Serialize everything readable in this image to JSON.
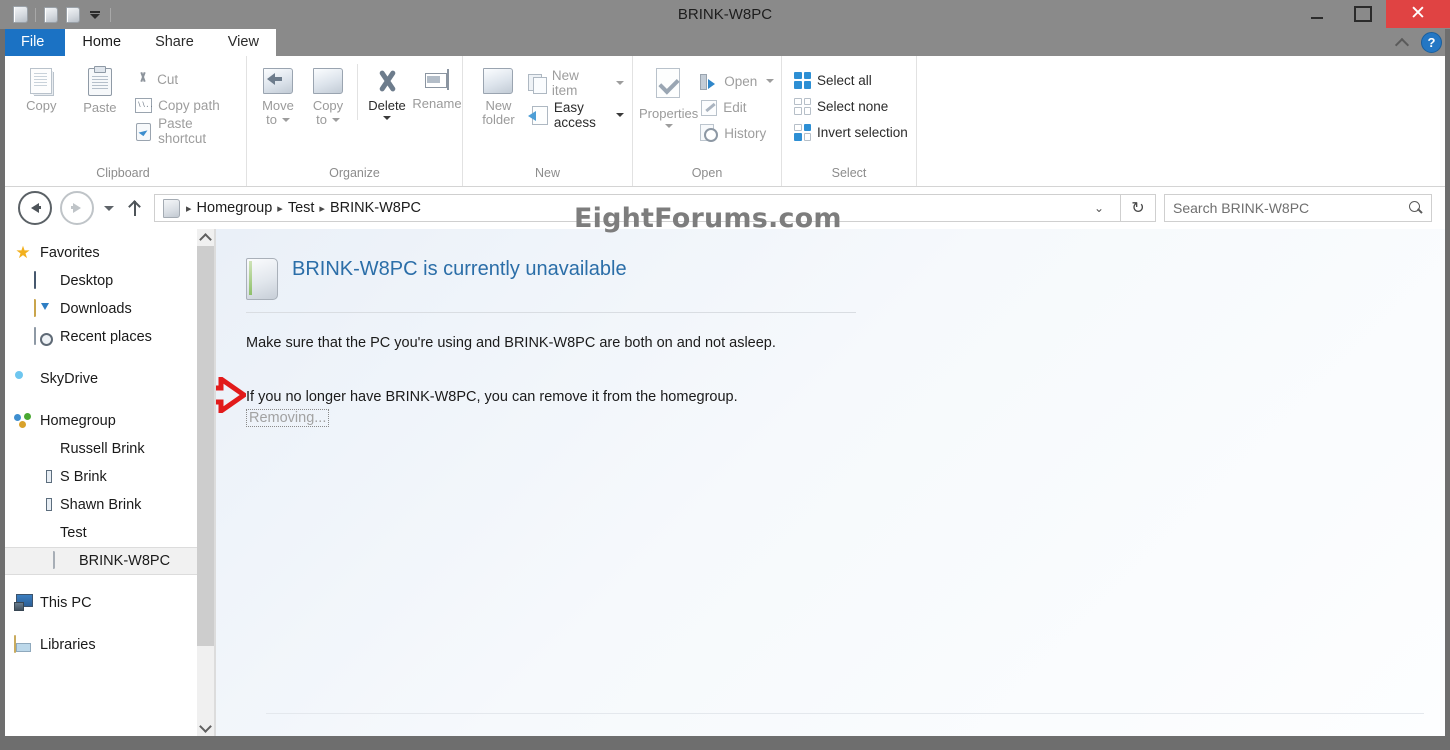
{
  "window": {
    "title": "BRINK-W8PC",
    "quick_access": [
      "folder-icon",
      "properties-icon",
      "new-folder-icon",
      "customize-dropdown-icon"
    ],
    "controls": {
      "minimize": "–",
      "maximize": "☐",
      "close": "✕"
    }
  },
  "ribbon": {
    "tabs": [
      {
        "label": "File",
        "id": "file",
        "active": false
      },
      {
        "label": "Home",
        "id": "home",
        "active": true
      },
      {
        "label": "Share",
        "id": "share",
        "active": false
      },
      {
        "label": "View",
        "id": "view",
        "active": false
      }
    ],
    "collapse_icon": "chevron-up-icon",
    "help_label": "?",
    "groups": [
      {
        "name": "Clipboard",
        "big": [
          {
            "label": "Copy",
            "icon": "copy-icon"
          },
          {
            "label": "Paste",
            "icon": "paste-icon"
          }
        ],
        "small": [
          {
            "label": "Cut",
            "icon": "scissors-icon"
          },
          {
            "label": "Copy path",
            "icon": "copy-path-icon"
          },
          {
            "label": "Paste shortcut",
            "icon": "paste-shortcut-icon"
          }
        ]
      },
      {
        "name": "Organize",
        "big": [
          {
            "label": "Move",
            "label2": "to",
            "icon": "move-to-icon",
            "dropdown": true
          },
          {
            "label": "Copy",
            "label2": "to",
            "icon": "copy-to-icon",
            "dropdown": true
          },
          {
            "label": "Delete",
            "icon": "delete-icon",
            "dropdown": true,
            "enabled": true
          },
          {
            "label": "Rename",
            "icon": "rename-icon"
          }
        ],
        "small": []
      },
      {
        "name": "New",
        "big": [
          {
            "label": "New",
            "label2": "folder",
            "icon": "new-folder-icon"
          }
        ],
        "small": [
          {
            "label": "New item",
            "icon": "new-item-icon",
            "dropdown": true
          },
          {
            "label": "Easy access",
            "icon": "easy-access-icon",
            "dropdown": true,
            "enabled": true
          }
        ]
      },
      {
        "name": "Open",
        "big": [
          {
            "label": "Properties",
            "icon": "properties-icon",
            "dropdown": true
          }
        ],
        "small": [
          {
            "label": "Open",
            "icon": "open-icon",
            "dropdown": true
          },
          {
            "label": "Edit",
            "icon": "edit-icon"
          },
          {
            "label": "History",
            "icon": "history-icon"
          }
        ]
      },
      {
        "name": "Select",
        "big": [],
        "small": [
          {
            "label": "Select all",
            "icon": "select-all-icon",
            "enabled": true
          },
          {
            "label": "Select none",
            "icon": "select-none-icon",
            "enabled": true
          },
          {
            "label": "Invert selection",
            "icon": "invert-selection-icon",
            "enabled": true
          }
        ]
      }
    ]
  },
  "addressbar": {
    "back_icon": "back-arrow-icon",
    "forward_icon": "forward-arrow-icon",
    "recent_icon": "recent-locations-dropdown-icon",
    "up_icon": "up-one-level-icon",
    "breadcrumb_icon": "computer-icon",
    "breadcrumbs": [
      "Homegroup",
      "Test",
      "BRINK-W8PC"
    ],
    "separator": "▸",
    "dropdown_icon": "⌄",
    "refresh_icon": "↻",
    "search_placeholder": "Search BRINK-W8PC",
    "search_value": "",
    "search_icon": "search-icon"
  },
  "navpane": {
    "items": [
      {
        "label": "Favorites",
        "icon": "star-icon",
        "level": 0
      },
      {
        "label": "Desktop",
        "icon": "desktop-icon",
        "level": 1
      },
      {
        "label": "Downloads",
        "icon": "downloads-icon",
        "level": 1
      },
      {
        "label": "Recent places",
        "icon": "recent-places-icon",
        "level": 1
      },
      {
        "label": "",
        "icon": "",
        "level": 0,
        "gap": true
      },
      {
        "label": "SkyDrive",
        "icon": "skydrive-icon",
        "level": 0
      },
      {
        "label": "",
        "icon": "",
        "level": 0,
        "gap": true
      },
      {
        "label": "Homegroup",
        "icon": "homegroup-icon",
        "level": 0
      },
      {
        "label": "Russell Brink",
        "icon": "user-icon",
        "level": 1
      },
      {
        "label": "S Brink",
        "icon": "user-photo-icon",
        "level": 1
      },
      {
        "label": "Shawn Brink",
        "icon": "user-photo-icon",
        "level": 1
      },
      {
        "label": "Test",
        "icon": "user-silhouette-icon",
        "level": 1
      },
      {
        "label": "BRINK-W8PC",
        "icon": "computer-icon",
        "level": 2,
        "selected": true
      },
      {
        "label": "",
        "icon": "",
        "level": 0,
        "gap": true
      },
      {
        "label": "This PC",
        "icon": "this-pc-icon",
        "level": 0
      },
      {
        "label": "",
        "icon": "",
        "level": 0,
        "gap": true
      },
      {
        "label": "Libraries",
        "icon": "libraries-icon",
        "level": 0
      }
    ],
    "scroll_up_icon": "chevron-up-icon",
    "scroll_down_icon": "chevron-down-icon"
  },
  "main": {
    "icon": "computer-icon",
    "title": "BRINK-W8PC is currently unavailable",
    "paragraph1": "Make sure that the PC you're using and BRINK-W8PC are both on and not asleep.",
    "paragraph2": "If you no longer have BRINK-W8PC, you can remove it from the homegroup.",
    "removing_link": "Removing...",
    "annotation_icon": "red-arrow-annotation",
    "annotation_color": "#e21b1b"
  },
  "watermark": {
    "text": "EightForums.com"
  },
  "colors": {
    "accent": "#1b72c4",
    "title_link": "#2b6ea8",
    "close_button": "#e04343",
    "titlebar": "#8a8a8a",
    "annotation": "#e21b1b"
  }
}
